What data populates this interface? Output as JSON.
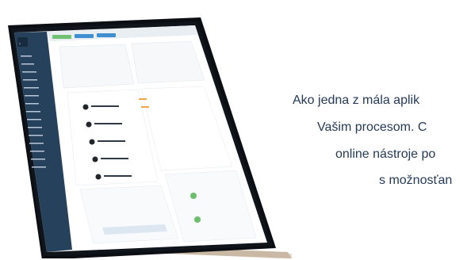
{
  "promo": {
    "line1": "Ako jedna z mála aplik",
    "line2": "Vašim procesom. C",
    "line3": "online nástroje po",
    "line4": "s možnosťan"
  },
  "ui": {
    "top_buttons": [
      "",
      "",
      ""
    ],
    "sidebar_items": [
      "",
      "",
      "",
      "",
      "",
      "",
      "",
      "",
      "",
      "",
      "",
      "",
      "",
      "",
      ""
    ],
    "colors": {
      "sidebar": "#1e3b57",
      "accent": "#6dbf6e",
      "blue": "#3a8ccf"
    }
  }
}
